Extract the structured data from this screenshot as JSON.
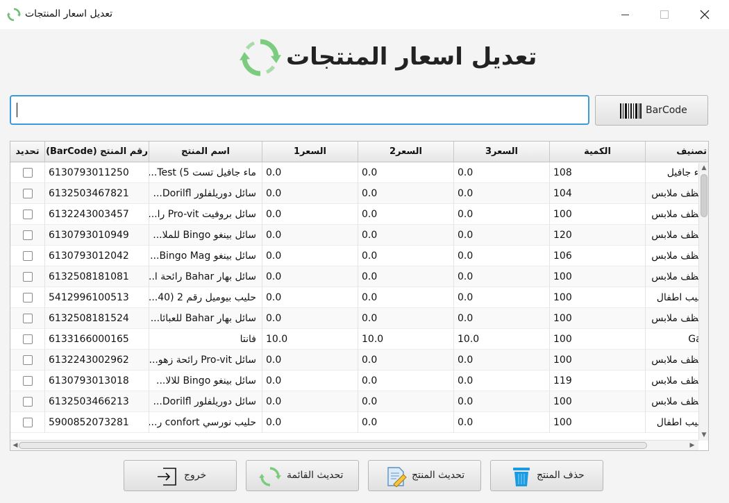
{
  "window": {
    "title": "تعديل اسعار المنتجات"
  },
  "heading": {
    "title": "تعديل اسعار المنتجات"
  },
  "search": {
    "value": "",
    "barcode_button": "BarCode"
  },
  "table": {
    "headers": {
      "update": "تحديد",
      "barcode": "رقم المنتج (BarCode)",
      "name": "اسم المنتج",
      "price1": "السعر1",
      "price2": "السعر2",
      "price3": "السعر3",
      "quantity": "الكمية",
      "category": "تصنيف"
    },
    "rows": [
      {
        "barcode": "6130793011250",
        "name": "ماء جافيل تست Test (5...",
        "price1": "0.0",
        "price2": "0.0",
        "price3": "0.0",
        "quantity": "108",
        "category": "ماء جافيل"
      },
      {
        "barcode": "6132503467821",
        "name": "سائل دوريلفلور Dorilfl...",
        "price1": "0.0",
        "price2": "0.0",
        "price3": "0.0",
        "quantity": "104",
        "category": "منظف ملابس"
      },
      {
        "barcode": "6132243003457",
        "name": "سائل بروفيت Pro-vit را...",
        "price1": "0.0",
        "price2": "0.0",
        "price3": "0.0",
        "quantity": "100",
        "category": "منظف ملابس"
      },
      {
        "barcode": "6130793010949",
        "name": "سائل بينغو Bingo للملا...",
        "price1": "0.0",
        "price2": "0.0",
        "price3": "0.0",
        "quantity": "120",
        "category": "منظف ملابس"
      },
      {
        "barcode": "6130793012042",
        "name": "سائل بينغو Bingo Mag...",
        "price1": "0.0",
        "price2": "0.0",
        "price3": "0.0",
        "quantity": "106",
        "category": "منظف ملابس"
      },
      {
        "barcode": "6132508181081",
        "name": "سائل بهار Bahar رائحة ا...",
        "price1": "0.0",
        "price2": "0.0",
        "price3": "0.0",
        "quantity": "100",
        "category": "منظف ملابس"
      },
      {
        "barcode": "5412996100513",
        "name": "حليب بيوميل رقم 2 (40...",
        "price1": "0.0",
        "price2": "0.0",
        "price3": "0.0",
        "quantity": "100",
        "category": "حليب اطفال"
      },
      {
        "barcode": "6132508181524",
        "name": "سائل بهار Bahar للعبائا...",
        "price1": "0.0",
        "price2": "0.0",
        "price3": "0.0",
        "quantity": "100",
        "category": "منظف ملابس"
      },
      {
        "barcode": "6133166000165",
        "name": "فانتا",
        "price1": "10.0",
        "price2": "10.0",
        "price3": "10.0",
        "quantity": "100",
        "category": "Gas"
      },
      {
        "barcode": "6132243002962",
        "name": "سائل Pro-vit رائحة زهو...",
        "price1": "0.0",
        "price2": "0.0",
        "price3": "0.0",
        "quantity": "100",
        "category": "منظف ملابس"
      },
      {
        "barcode": "6130793013018",
        "name": "سائل بينغو Bingo للالا...",
        "price1": "0.0",
        "price2": "0.0",
        "price3": "0.0",
        "quantity": "119",
        "category": "منظف ملابس"
      },
      {
        "barcode": "6132503466213",
        "name": "سائل دوريلفلور Dorilfl...",
        "price1": "0.0",
        "price2": "0.0",
        "price3": "0.0",
        "quantity": "100",
        "category": "منظف ملابس"
      },
      {
        "barcode": "5900852073281",
        "name": "حليب نورسي confort ر...",
        "price1": "0.0",
        "price2": "0.0",
        "price3": "0.0",
        "quantity": "100",
        "category": "حليب اطفال"
      }
    ]
  },
  "buttons": {
    "exit": "خروج",
    "refresh": "تحديث القائمة",
    "update": "تحديث المنتج",
    "delete": "حذف المنتج"
  },
  "colors": {
    "accent_focus": "#3b99dc",
    "refresh_icon": "#6fbf73",
    "delete_icon": "#1a9be0"
  }
}
